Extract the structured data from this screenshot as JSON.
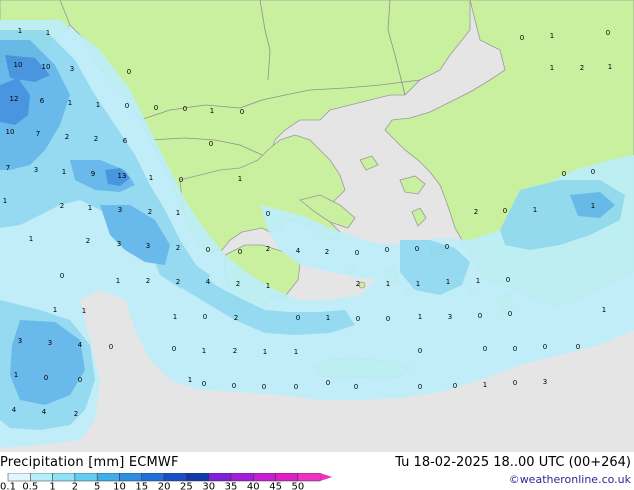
{
  "footer": {
    "title_left": "Precipitation [mm]",
    "title_model": "ECMWF",
    "valid_time": "Tu 18-02-2025 18..00 UTC (00+264)",
    "credit": "©weatheronline.co.uk"
  },
  "legend": {
    "labels": [
      "0.1",
      "0.5",
      "1",
      "2",
      "5",
      "10",
      "15",
      "20",
      "25",
      "30",
      "35",
      "40",
      "45",
      "50"
    ],
    "colors": [
      "#e0f8fc",
      "#b4eef9",
      "#8ee2f5",
      "#64cdf0",
      "#41aeea",
      "#2f8ee4",
      "#236fd8",
      "#1a4ec6",
      "#123aa5",
      "#7f1fd6",
      "#a21fd9",
      "#c41fd1",
      "#dd1fc7",
      "#ee33c3"
    ]
  },
  "map": {
    "colors": {
      "land": "#c9f09e",
      "sea_dry": "#e5e5e5",
      "light_precip": "#bdeefa",
      "moderate_precip": "#8fdaf3",
      "heavy_precip": "#5fb6ec",
      "very_heavy_precip": "#3d8fe0",
      "border": "#9a9a9a"
    },
    "labels": [
      {
        "v": "1"
      },
      {
        "v": "1"
      },
      {
        "v": "10"
      },
      {
        "v": "10"
      },
      {
        "v": "3"
      },
      {
        "v": "0"
      },
      {
        "v": "12"
      },
      {
        "v": "6"
      },
      {
        "v": "1"
      },
      {
        "v": "1"
      },
      {
        "v": "0"
      },
      {
        "v": "0"
      },
      {
        "v": "0"
      },
      {
        "v": "1"
      },
      {
        "v": "0"
      },
      {
        "v": "10"
      },
      {
        "v": "7"
      },
      {
        "v": "2"
      },
      {
        "v": "2"
      },
      {
        "v": "6"
      },
      {
        "v": "7"
      },
      {
        "v": "3"
      },
      {
        "v": "1"
      },
      {
        "v": "9"
      },
      {
        "v": "13"
      },
      {
        "v": "1"
      },
      {
        "v": "0"
      },
      {
        "v": "0"
      },
      {
        "v": "1"
      },
      {
        "v": "1"
      },
      {
        "v": "2"
      },
      {
        "v": "1"
      },
      {
        "v": "3"
      },
      {
        "v": "2"
      },
      {
        "v": "1"
      },
      {
        "v": "0"
      },
      {
        "v": "1"
      },
      {
        "v": "2"
      },
      {
        "v": "3"
      },
      {
        "v": "3"
      },
      {
        "v": "2"
      },
      {
        "v": "0"
      },
      {
        "v": "0"
      },
      {
        "v": "2"
      },
      {
        "v": "4"
      },
      {
        "v": "2"
      },
      {
        "v": "0"
      },
      {
        "v": "0"
      },
      {
        "v": "0"
      },
      {
        "v": "0"
      },
      {
        "v": "2"
      },
      {
        "v": "0"
      },
      {
        "v": "1"
      },
      {
        "v": "0"
      },
      {
        "v": "0"
      },
      {
        "v": "1"
      },
      {
        "v": "0"
      },
      {
        "v": "1"
      },
      {
        "v": "2"
      },
      {
        "v": "2"
      },
      {
        "v": "4"
      },
      {
        "v": "2"
      },
      {
        "v": "1"
      },
      {
        "v": "2"
      },
      {
        "v": "1"
      },
      {
        "v": "1"
      },
      {
        "v": "1"
      },
      {
        "v": "1"
      },
      {
        "v": "0"
      },
      {
        "v": "3"
      },
      {
        "v": "3"
      },
      {
        "v": "4"
      },
      {
        "v": "0"
      },
      {
        "v": "0"
      },
      {
        "v": "1"
      },
      {
        "v": "2"
      },
      {
        "v": "1"
      },
      {
        "v": "1"
      },
      {
        "v": "1"
      },
      {
        "v": "0"
      },
      {
        "v": "1"
      },
      {
        "v": "1"
      },
      {
        "v": "2"
      },
      {
        "v": "0"
      },
      {
        "v": "1"
      },
      {
        "v": "0"
      },
      {
        "v": "0"
      },
      {
        "v": "1"
      },
      {
        "v": "3"
      },
      {
        "v": "0"
      },
      {
        "v": "0"
      },
      {
        "v": "1"
      },
      {
        "v": "0"
      },
      {
        "v": "0"
      },
      {
        "v": "1"
      },
      {
        "v": "0"
      },
      {
        "v": "0"
      },
      {
        "v": "0"
      },
      {
        "v": "0"
      },
      {
        "v": "0"
      },
      {
        "v": "4"
      },
      {
        "v": "4"
      },
      {
        "v": "2"
      },
      {
        "v": "0"
      },
      {
        "v": "0"
      },
      {
        "v": "0"
      },
      {
        "v": "0"
      },
      {
        "v": "0"
      },
      {
        "v": "0"
      },
      {
        "v": "0"
      },
      {
        "v": "1"
      },
      {
        "v": "0"
      },
      {
        "v": "1"
      },
      {
        "v": "0"
      },
      {
        "v": "3"
      },
      {
        "v": "1"
      },
      {
        "v": "2"
      },
      {
        "v": "1"
      },
      {
        "v": "0"
      },
      {
        "v": "1"
      },
      {
        "v": "0"
      }
    ]
  }
}
